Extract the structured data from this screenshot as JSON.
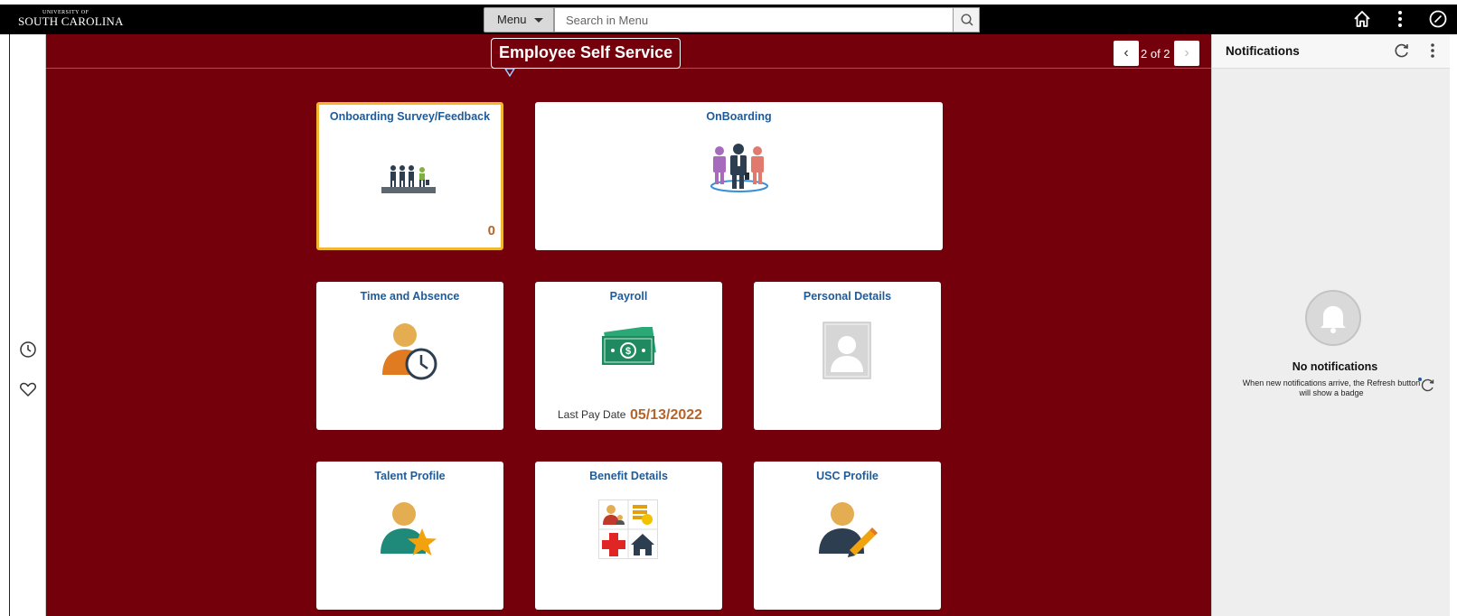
{
  "header": {
    "logo_small": "UNIVERSITY OF",
    "logo_big": "SOUTH CAROLINA",
    "menu_label": "Menu",
    "search_placeholder": "Search in Menu",
    "icons": [
      "home-icon",
      "more-options-icon",
      "navbar-compass-icon"
    ]
  },
  "left_rail": {
    "icons": [
      "recent-history-icon",
      "favorites-heart-icon"
    ]
  },
  "page": {
    "title": "Employee Self Service",
    "pager": "2 of 2",
    "prev_symbol": "‹",
    "next_symbol": "›"
  },
  "tiles": {
    "onboarding_survey": {
      "title": "Onboarding Survey/Feedback",
      "count": "0"
    },
    "onboarding": {
      "title": "OnBoarding"
    },
    "time_absence": {
      "title": "Time and Absence"
    },
    "payroll": {
      "title": "Payroll",
      "pay_label": "Last Pay Date",
      "pay_date": "05/13/2022"
    },
    "personal_details": {
      "title": "Personal Details"
    },
    "talent_profile": {
      "title": "Talent Profile"
    },
    "benefit_details": {
      "title": "Benefit Details"
    },
    "usc_profile": {
      "title": "USC Profile"
    }
  },
  "notifications": {
    "title": "Notifications",
    "empty_title": "No notifications",
    "empty_desc": "When new notifications arrive, the Refresh button will show a badge"
  },
  "colors": {
    "maroon": "#73000a",
    "tile_title": "#1f5b99",
    "accent_orange": "#b5652a",
    "focus_gold": "#f2b731"
  }
}
